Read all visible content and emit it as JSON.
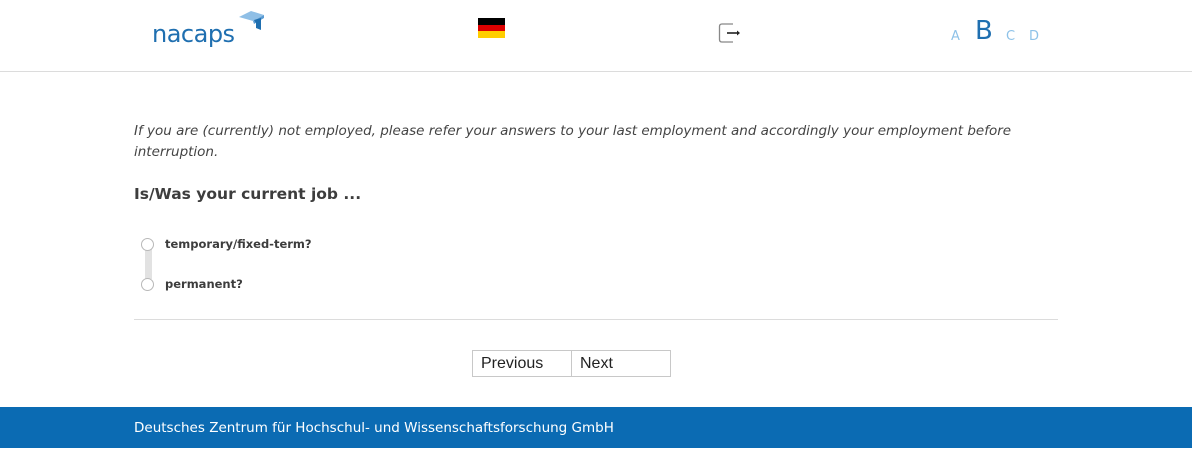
{
  "header": {
    "logo_text": "nacaps",
    "language_flag": "german-flag-icon",
    "logout_icon": "logout-icon",
    "font_size_options": [
      {
        "label": "A",
        "selected": false
      },
      {
        "label": "B",
        "selected": true
      },
      {
        "label": "C",
        "selected": false
      },
      {
        "label": "D",
        "selected": false
      }
    ]
  },
  "main": {
    "instruction": "If you are (currently) not employed, please refer your answers to your last employment and accordingly your employment before interruption.",
    "question": "Is/Was your current job ...",
    "options": [
      {
        "label": "temporary/fixed-term?",
        "selected": false
      },
      {
        "label": "permanent?",
        "selected": false
      }
    ]
  },
  "navigation": {
    "previous_label": "Previous",
    "next_label": "Next"
  },
  "footer": {
    "text": "Deutsches Zentrum für Hochschul- und Wissenschaftsforschung GmbH"
  },
  "colors": {
    "brand_blue": "#1f6fb0",
    "footer_blue": "#0b6bb3",
    "light_blue": "#8ec2e8"
  }
}
